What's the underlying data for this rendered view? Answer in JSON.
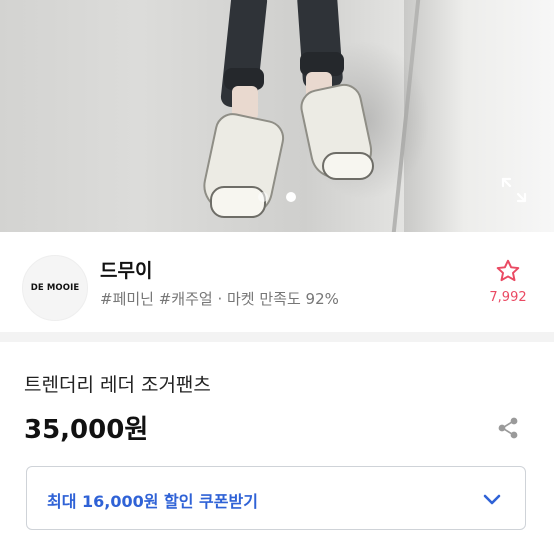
{
  "gallery": {
    "total_slides": 2,
    "active_slide": 2,
    "expand_icon": "expand-icon"
  },
  "shop": {
    "logo_text": "DE MOOIE",
    "name": "드무이",
    "tags": "#페미닌 #캐주얼 · 마켓 만족도 92%",
    "favorite_icon": "star-outline-icon",
    "favorite_count": "7,992"
  },
  "product": {
    "title": "트렌더리 레더 조거팬츠",
    "price": "35,000원",
    "share_icon": "share-icon"
  },
  "coupon": {
    "label": "최대 16,000원 할인 쿠폰받기",
    "icon": "chevron-down-icon"
  },
  "colors": {
    "accent_blue": "#2f62d6",
    "favorite_pink": "#ea4a63"
  }
}
